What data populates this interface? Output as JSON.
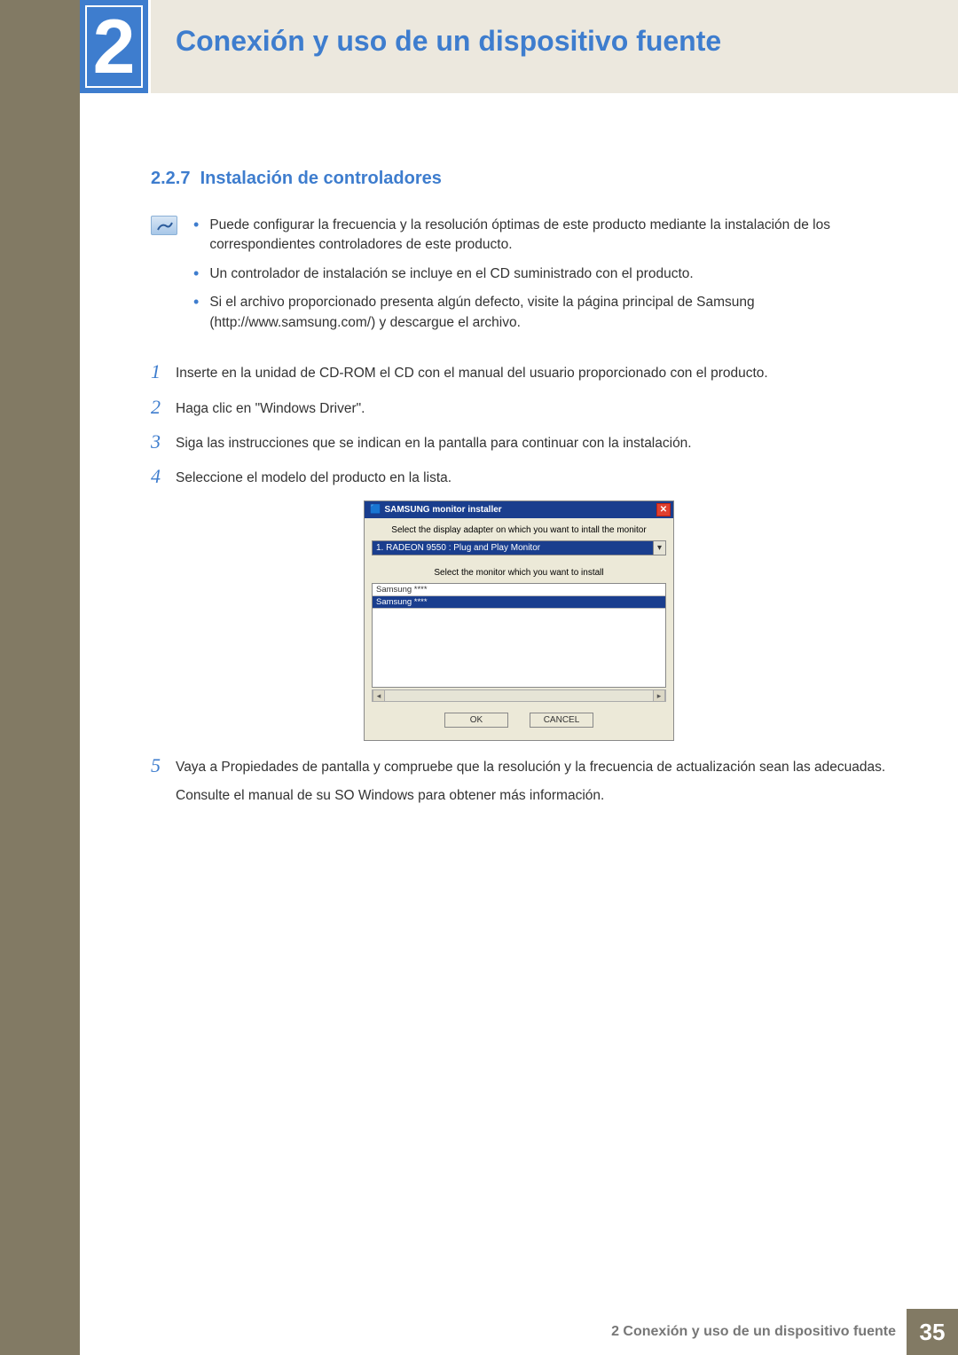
{
  "chapter": {
    "number": "2",
    "title": "Conexión y uso de un dispositivo fuente"
  },
  "section": {
    "number": "2.2.7",
    "title": "Instalación de controladores"
  },
  "notes": [
    "Puede configurar la frecuencia y la resolución óptimas de este producto mediante la instalación de los correspondientes controladores de este producto.",
    "Un controlador de instalación se incluye en el CD suministrado con el producto.",
    "Si el archivo proporcionado presenta algún defecto, visite la página principal de Samsung (http://www.samsung.com/) y descargue el archivo."
  ],
  "steps": {
    "s1": "Inserte en la unidad de CD-ROM el CD con el manual del usuario proporcionado con el producto.",
    "s2": "Haga clic en \"Windows Driver\".",
    "s3": "Siga las instrucciones que se indican en la pantalla para continuar con la instalación.",
    "s4": "Seleccione el modelo del producto en la lista.",
    "s5": "Vaya a Propiedades de pantalla y compruebe que la resolución y la frecuencia de actualización sean las adecuadas.",
    "s5_extra": "Consulte el manual de su SO Windows para obtener más información."
  },
  "dialog": {
    "title": "SAMSUNG monitor installer",
    "label_adapter": "Select the display adapter on which you want to intall the monitor",
    "adapter_value": "1. RADEON 9550 : Plug and Play Monitor",
    "label_monitor": "Select the monitor which you want to install",
    "list_item_a": "Samsung ****",
    "list_item_b": "Samsung ****",
    "btn_ok": "OK",
    "btn_cancel": "CANCEL"
  },
  "footer": {
    "text": "2 Conexión y uso de un dispositivo fuente",
    "page": "35"
  }
}
